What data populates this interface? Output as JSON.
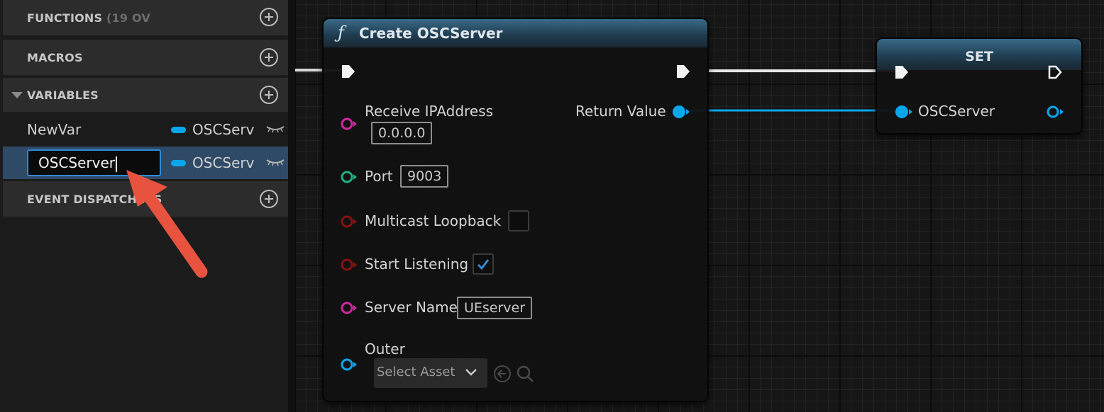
{
  "panel": {
    "functions": {
      "label": "FUNCTIONS",
      "count": "(19 OV"
    },
    "macros": {
      "label": "MACROS"
    },
    "variables": {
      "label": "VARIABLES",
      "items": [
        {
          "name": "NewVar",
          "type": "OSCServ"
        },
        {
          "name": "OSCServer",
          "type": "OSCServ"
        }
      ]
    },
    "event_dispatchers": {
      "label": "EVENT DISPATCHERS"
    }
  },
  "create_node": {
    "title": "Create OSCServer",
    "fn_symbol": "ƒ",
    "pins": {
      "receive_ip": {
        "label": "Receive IPAddress",
        "value": "0.0.0.0"
      },
      "port": {
        "label": "Port",
        "value": "9003"
      },
      "multicast": {
        "label": "Multicast Loopback",
        "checked": false
      },
      "start_listening": {
        "label": "Start Listening",
        "checked": true
      },
      "server_name": {
        "label": "Server Name",
        "value": "UEserver"
      },
      "outer": {
        "label": "Outer",
        "asset_placeholder": "Select Asset"
      }
    },
    "return_label": "Return Value"
  },
  "set_node": {
    "title": "SET",
    "pin_label": "OSCServer"
  },
  "colors": {
    "object_pin": "#0aa6ec",
    "string_pin": "#d1279c",
    "int_pin": "#1fae84",
    "bool_pin": "#8a1010",
    "header_accent": "#3a6a86",
    "annotation_arrow": "#e8533f"
  }
}
